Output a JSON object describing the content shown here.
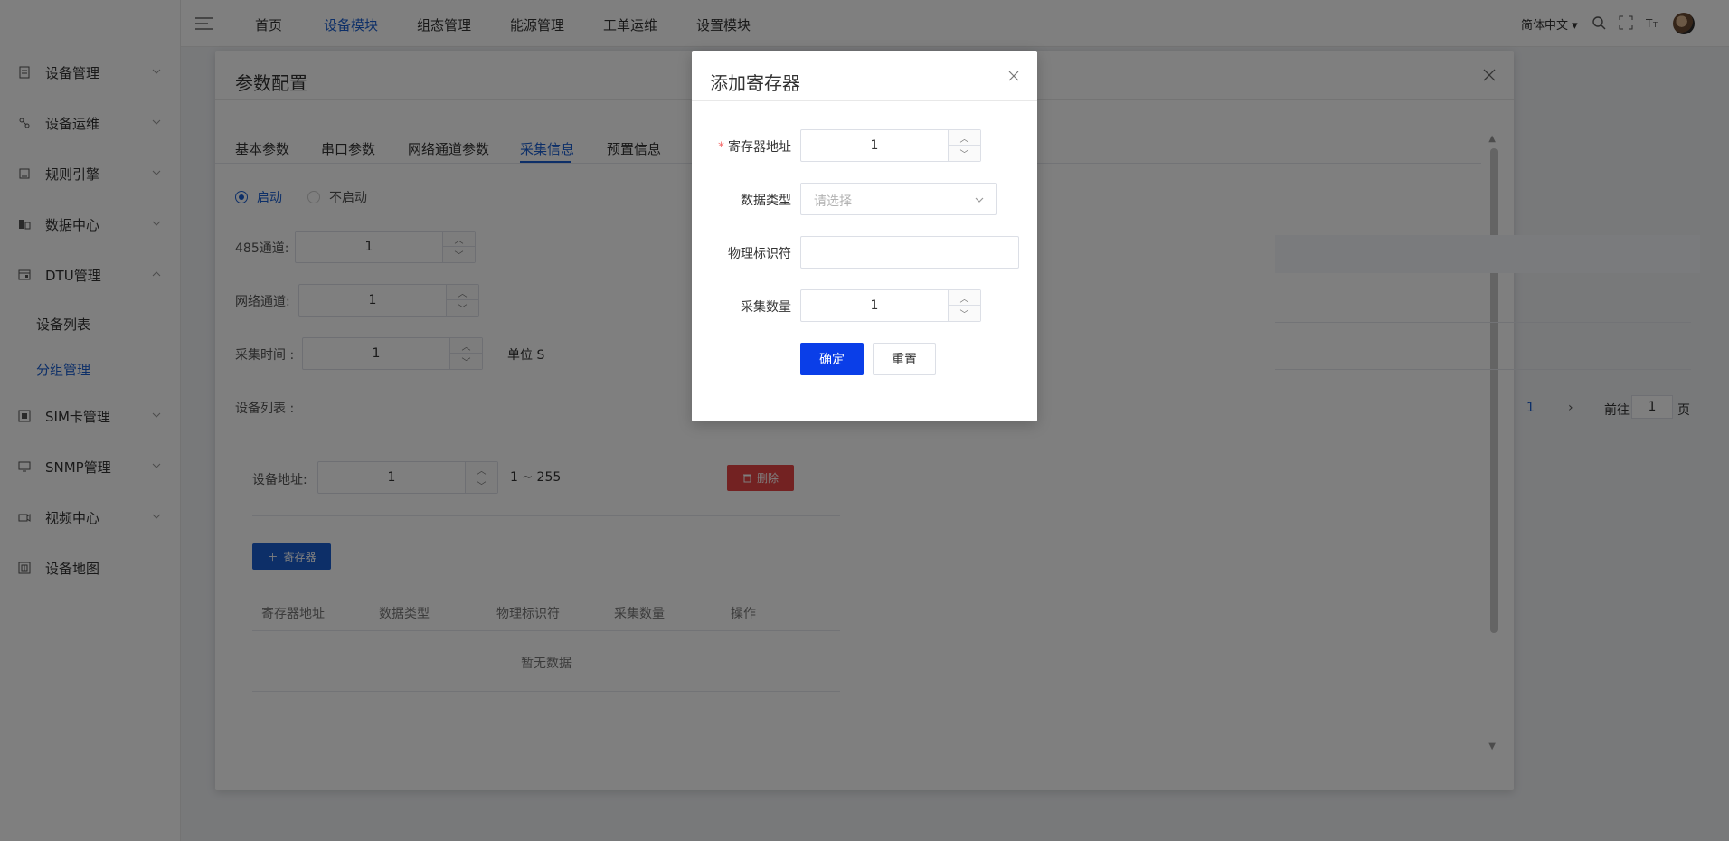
{
  "sidebar": {
    "items": [
      {
        "label": "设备管理",
        "icon": "clipboard-icon"
      },
      {
        "label": "设备运维",
        "icon": "nodes-icon"
      },
      {
        "label": "规则引擎",
        "icon": "document-icon"
      },
      {
        "label": "数据中心",
        "icon": "database-icon"
      },
      {
        "label": "DTU管理",
        "icon": "dtu-icon"
      },
      {
        "label": "SIM卡管理",
        "icon": "sim-card-icon"
      },
      {
        "label": "SNMP管理",
        "icon": "monitor-icon"
      },
      {
        "label": "视频中心",
        "icon": "camera-icon"
      },
      {
        "label": "设备地图",
        "icon": "map-icon"
      }
    ],
    "sub_items": [
      "设备列表",
      "分组管理"
    ]
  },
  "topnav": {
    "tabs": [
      "首页",
      "设备模块",
      "组态管理",
      "能源管理",
      "工单运维",
      "设置模块"
    ],
    "active": "设备模块",
    "language": "简体中文"
  },
  "panel": {
    "title": "参数配置",
    "tabs": [
      "基本参数",
      "串口参数",
      "网络通道参数",
      "采集信息",
      "预置信息"
    ],
    "active_tab": "采集信息",
    "radio_on": "启动",
    "radio_off": "不启动",
    "ch485_label": "485通道:",
    "ch485_value": "1",
    "net_label": "网络通道:",
    "net_value": "1",
    "time_label": "采集时间 :",
    "time_value": "1",
    "time_unit": "单位 S",
    "device_list_label": "设备列表 :",
    "device_addr_label": "设备地址:",
    "device_addr_value": "1",
    "device_addr_range": "1 ~ 255",
    "delete_label": "删除",
    "add_register_label": "寄存器",
    "table_headers": [
      "寄存器地址",
      "数据类型",
      "物理标识符",
      "采集数量",
      "操作"
    ],
    "empty_text": "暂无数据"
  },
  "pager": {
    "current": "1",
    "goto_prefix": "前往",
    "goto_value": "1",
    "goto_suffix": "页"
  },
  "dialog": {
    "title": "添加寄存器",
    "fields": {
      "register_addr_label": "寄存器地址",
      "register_addr_value": "1",
      "data_type_label": "数据类型",
      "data_type_placeholder": "请选择",
      "physical_id_label": "物理标识符",
      "physical_id_value": "",
      "count_label": "采集数量",
      "count_value": "1"
    },
    "confirm_label": "确定",
    "reset_label": "重置"
  },
  "colors": {
    "accent": "#1a5fd1",
    "primary_button": "#0a3ee8",
    "danger": "#e64545",
    "required": "#f56c6c"
  }
}
